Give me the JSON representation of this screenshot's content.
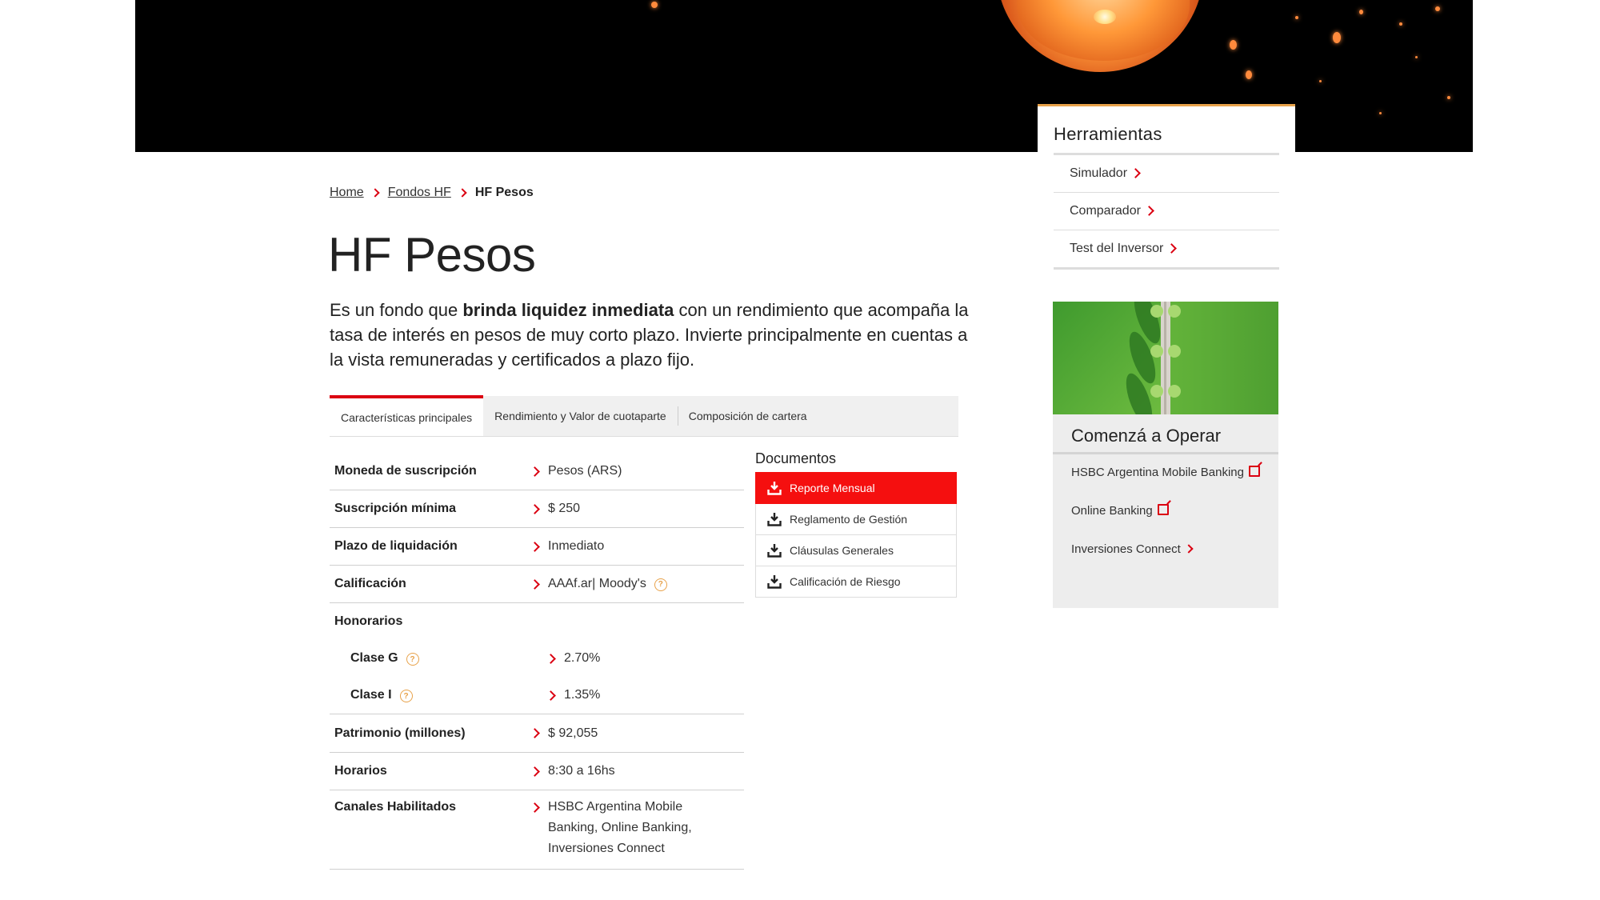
{
  "colors": {
    "brand_red": "#db0011",
    "active_doc": "#f50f0f",
    "accent_orange": "#e8a24a"
  },
  "breadcrumb": [
    {
      "label": "Home"
    },
    {
      "label": "Fondos HF"
    },
    {
      "label": "HF Pesos"
    }
  ],
  "page": {
    "title": "HF Pesos",
    "intro_before": "Es un fondo que ",
    "intro_bold": "brinda liquidez inmediata",
    "intro_after": " con un rendimiento que acompaña la tasa de interés en pesos de muy corto plazo. Invierte principalmente en cuentas a la vista remuneradas y certificados a plazo fijo."
  },
  "tabs": [
    {
      "label": "Características principales",
      "active": true
    },
    {
      "label": "Rendimiento y Valor de cuotaparte",
      "active": false
    },
    {
      "label": "Composición de cartera",
      "active": false
    }
  ],
  "specs": {
    "moneda": {
      "label": "Moneda de suscripción",
      "value": "Pesos (ARS)"
    },
    "suscripcion": {
      "label": "Suscripción mínima",
      "value": "$ 250"
    },
    "plazo": {
      "label": "Plazo de liquidación",
      "value": "Inmediato"
    },
    "calificacion": {
      "label": "Calificación",
      "value": "AAAf.ar| Moody's"
    },
    "honorarios": {
      "label": "Honorarios"
    },
    "clase_g": {
      "label": "Clase G",
      "value": "2.70%"
    },
    "clase_i": {
      "label": "Clase I",
      "value": "1.35%"
    },
    "patrimonio": {
      "label": "Patrimonio (millones)",
      "value": "$ 92,055"
    },
    "horarios": {
      "label": "Horarios",
      "value": "8:30 a 16hs"
    },
    "canales": {
      "label": "Canales Habilitados",
      "value": "HSBC Argentina Mobile Banking, Online Banking, Inversiones Connect"
    }
  },
  "documents": {
    "title": "Documentos",
    "items": [
      {
        "label": "Reporte Mensual",
        "icon": "download-icon",
        "active": true
      },
      {
        "label": "Reglamento de Gestión",
        "icon": "download-icon",
        "active": false
      },
      {
        "label": "Cláusulas Generales",
        "icon": "download-icon",
        "active": false
      },
      {
        "label": "Calificación de Riesgo",
        "icon": "download-icon",
        "active": false
      }
    ]
  },
  "tools": {
    "title": "Herramientas",
    "items": [
      {
        "label": "Simulador"
      },
      {
        "label": "Comparador"
      },
      {
        "label": "Test del Inversor"
      }
    ]
  },
  "operate": {
    "title": "Comenzá a Operar",
    "items": [
      {
        "label": "HSBC Argentina Mobile Banking",
        "icon": "external-link-icon"
      },
      {
        "label": "Online Banking",
        "icon": "external-link-icon"
      },
      {
        "label": "Inversiones Connect",
        "icon": "chevron-right-icon"
      }
    ]
  }
}
